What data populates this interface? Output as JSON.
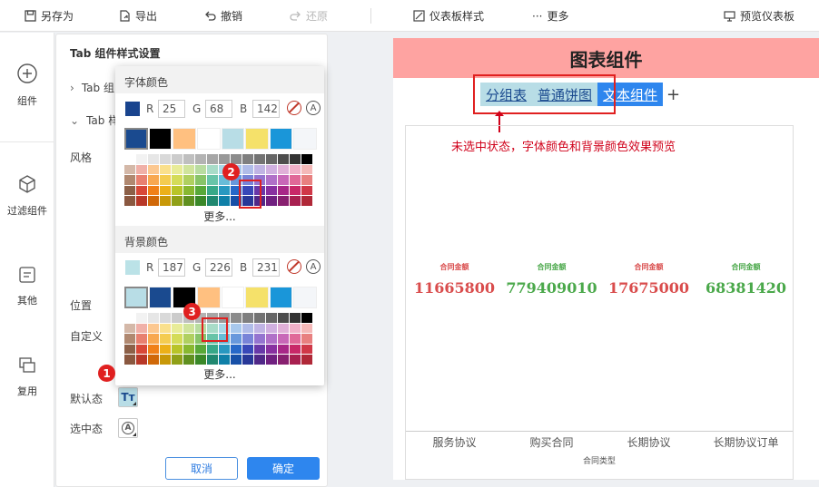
{
  "toolbar": {
    "save_as": "另存为",
    "export": "导出",
    "undo": "撤销",
    "redo": "还原",
    "dashboard_style": "仪表板样式",
    "more": "更多",
    "preview": "预览仪表板"
  },
  "sidebar": {
    "items": [
      {
        "label": "组件",
        "icon": "plus-circle-icon"
      },
      {
        "label": "过滤组件",
        "icon": "cube-icon"
      },
      {
        "label": "其他",
        "icon": "document-icon"
      },
      {
        "label": "复用",
        "icon": "copy-icon"
      }
    ]
  },
  "panel": {
    "title": "Tab 组件样式设置",
    "sec1": "Tab 组",
    "sec2": "Tab 样",
    "style": "风格",
    "position": "位置",
    "custom": "自定义",
    "default_state": "默认态",
    "selected_state": "选中态",
    "cancel": "取消",
    "ok": "确定",
    "tt_label": "Tт",
    "a_label": "A"
  },
  "picker": {
    "font_color": {
      "title": "字体颜色",
      "r": "25",
      "g": "68",
      "b": "142",
      "hex": "#19448e"
    },
    "bg_color": {
      "title": "背景颜色",
      "r": "187",
      "g": "226",
      "b": "231",
      "hex": "#bbe2e7"
    },
    "more": "更多...",
    "R": "R",
    "G": "G",
    "B": "B"
  },
  "palette": {
    "recent_font": [
      "#1a4a8f",
      "#000000",
      "#ffc080",
      "#ffffff",
      "#b8dde6",
      "#f5e16a",
      "#1a96d9",
      "#f4f6f9"
    ],
    "recent_bg": [
      "#b8dde6",
      "#1a4a8f",
      "#000000",
      "#ffc080",
      "#ffffff",
      "#f5e16a",
      "#1a96d9",
      "#f4f6f9"
    ],
    "grays": [
      "#ffffff",
      "#f2f2f2",
      "#e6e6e6",
      "#d9d9d9",
      "#cccccc",
      "#bfbfbf",
      "#b3b3b3",
      "#a6a6a6",
      "#999999",
      "#8c8c8c",
      "#7f7f7f",
      "#737373",
      "#666666",
      "#4d4d4d",
      "#333333",
      "#000000"
    ],
    "rows": [
      [
        "#d4b8a8",
        "#f0b0a8",
        "#fcc890",
        "#fae08c",
        "#e8ec98",
        "#d0e49c",
        "#b8dca0",
        "#a8dcc8",
        "#a8d8e8",
        "#a8c8ec",
        "#b0bce8",
        "#c0b4e4",
        "#d0b0e0",
        "#e0b0d8",
        "#f0b0c8",
        "#f4b8b8"
      ],
      [
        "#b08870",
        "#e88070",
        "#f8a850",
        "#f4cc50",
        "#d4dc58",
        "#b0d060",
        "#88c468",
        "#68c4a8",
        "#68bcd8",
        "#6898dc",
        "#7884d8",
        "#9474d0",
        "#b070c8",
        "#c868b8",
        "#e06898",
        "#e88080"
      ],
      [
        "#8c6048",
        "#d84838",
        "#f08018",
        "#ecb018",
        "#b8c428",
        "#88b830",
        "#58a838",
        "#38a888",
        "#2898c0",
        "#2868c8",
        "#3848b8",
        "#6838a8",
        "#8830a0",
        "#a82888",
        "#c82868",
        "#d03848"
      ]
    ]
  },
  "canvas": {
    "title": "图表组件",
    "tabs": [
      "分组表",
      "普通饼图",
      "文本组件"
    ],
    "plus": "+",
    "note": "未选中状态，字体颜色和背景颜色效果预览",
    "xlabel": "合同类型"
  },
  "chart_data": {
    "type": "table",
    "categories": [
      "服务协议",
      "购买合同",
      "长期协议",
      "长期协议订单"
    ],
    "series": [
      {
        "name": "合同金额",
        "values": [
          11665800,
          779409010,
          17675000,
          68381420
        ]
      }
    ],
    "labels": [
      "11665800",
      "779409010",
      "17675000",
      "68381420"
    ],
    "colors": [
      "#d94c4c",
      "#4aa84a",
      "#d94c4c",
      "#4aa84a"
    ]
  }
}
